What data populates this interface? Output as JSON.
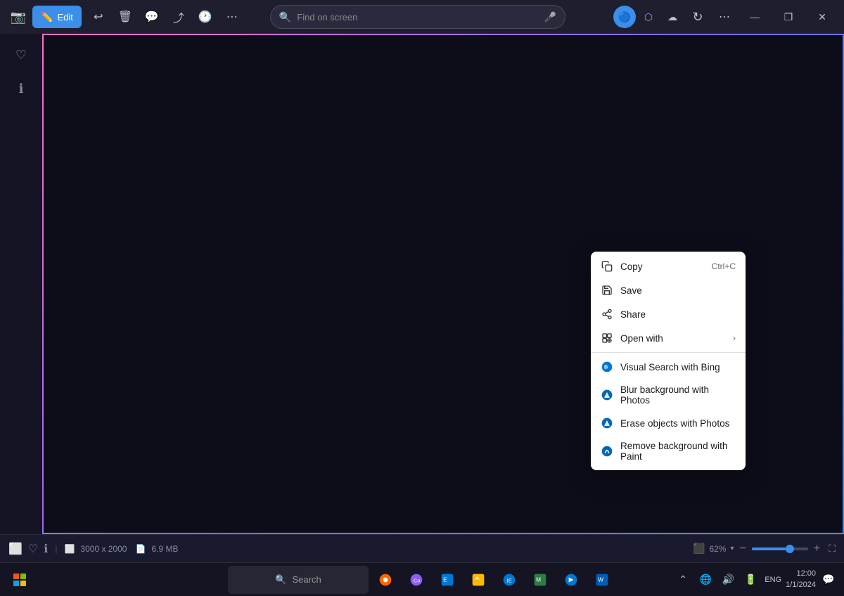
{
  "titlebar": {
    "edit_label": "Edit",
    "search_placeholder": "Find on screen",
    "search_icon": "🔍",
    "mic_icon": "🎤",
    "refresh_icon": "↻",
    "more_icon": "⋯",
    "minimize_label": "—",
    "restore_label": "❐",
    "close_label": "✕",
    "icon_undo": "↩",
    "icon_delete": "🗑",
    "icon_chat": "💬",
    "icon_share": "⤴",
    "icon_history": "🕐",
    "icon_more": "⋯",
    "top_icon1": "🔵",
    "top_icon2": "🟣",
    "top_icon3": "☁"
  },
  "context_menu": {
    "items": [
      {
        "id": "copy",
        "label": "Copy",
        "shortcut": "Ctrl+C",
        "icon": "copy",
        "has_arrow": false
      },
      {
        "id": "save",
        "label": "Save",
        "shortcut": "",
        "icon": "save",
        "has_arrow": false
      },
      {
        "id": "share",
        "label": "Share",
        "shortcut": "",
        "icon": "share",
        "has_arrow": false
      },
      {
        "id": "open_with",
        "label": "Open with",
        "shortcut": "",
        "icon": "open",
        "has_arrow": true
      },
      {
        "id": "visual_search",
        "label": "Visual Search with Bing",
        "shortcut": "",
        "icon": "bing",
        "has_arrow": false,
        "special": true
      },
      {
        "id": "blur_bg",
        "label": "Blur background with Photos",
        "shortcut": "",
        "icon": "photos",
        "has_arrow": false,
        "special": true
      },
      {
        "id": "erase_objects",
        "label": "Erase objects with Photos",
        "shortcut": "",
        "icon": "photos",
        "has_arrow": false,
        "special": true
      },
      {
        "id": "remove_bg",
        "label": "Remove background with Paint",
        "shortcut": "",
        "icon": "paint",
        "has_arrow": false,
        "special": true
      }
    ]
  },
  "status_bar": {
    "dimensions": "3000 x 2000",
    "filesize": "6.9 MB",
    "zoom": "62%",
    "zoom_percent": 62
  },
  "taskbar": {
    "search_placeholder": "Search",
    "time": "12:00",
    "date": "1/1/2024"
  }
}
